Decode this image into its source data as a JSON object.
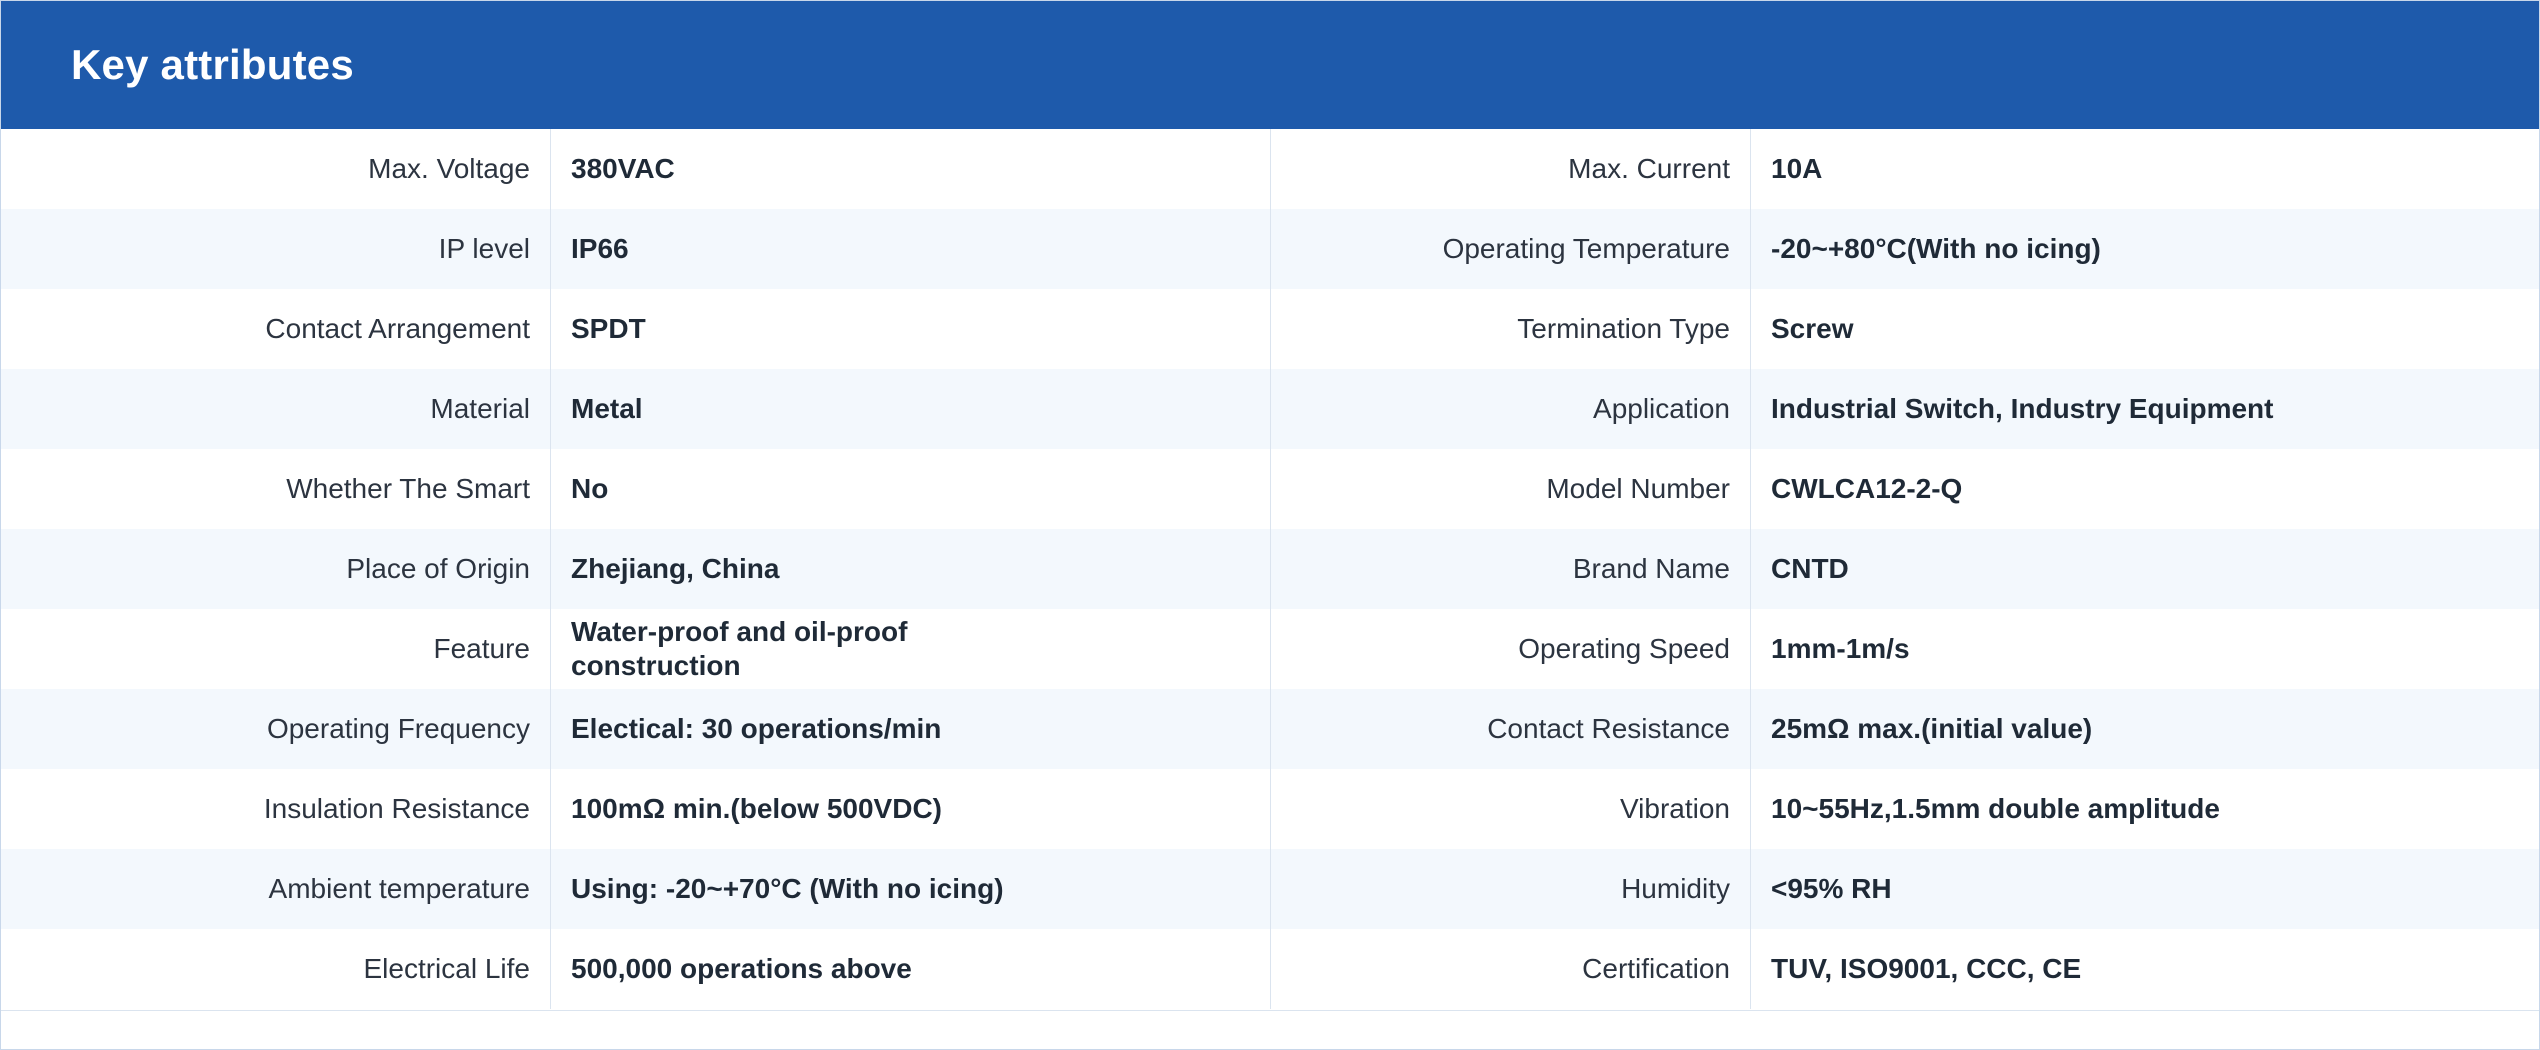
{
  "header": {
    "title": "Key attributes",
    "color": "#1e5aab"
  },
  "rows": [
    {
      "left_label": "Max. Voltage",
      "left_value": "380VAC",
      "right_label": "Max. Current",
      "right_value": "10A"
    },
    {
      "left_label": "IP level",
      "left_value": "IP66",
      "right_label": "Operating Temperature",
      "right_value": "-20~+80°C(With no icing)"
    },
    {
      "left_label": "Contact Arrangement",
      "left_value": "SPDT",
      "right_label": "Termination Type",
      "right_value": "Screw"
    },
    {
      "left_label": "Material",
      "left_value": "Metal",
      "right_label": "Application",
      "right_value": "Industrial Switch, Industry Equipment"
    },
    {
      "left_label": "Whether The Smart",
      "left_value": "No",
      "right_label": "Model Number",
      "right_value": "CWLCA12-2-Q"
    },
    {
      "left_label": "Place of Origin",
      "left_value": "Zhejiang, China",
      "right_label": "Brand Name",
      "right_value": "CNTD"
    },
    {
      "left_label": "Feature",
      "left_value": "Water-proof and oil-proof construction",
      "right_label": "Operating Speed",
      "right_value": "1mm-1m/s"
    },
    {
      "left_label": "Operating Frequency",
      "left_value": "Electical: 30 operations/min",
      "right_label": "Contact Resistance",
      "right_value": "25mΩ max.(initial value)"
    },
    {
      "left_label": "Insulation Resistance",
      "left_value": "100mΩ min.(below 500VDC)",
      "right_label": "Vibration",
      "right_value": "10~55Hz,1.5mm double amplitude"
    },
    {
      "left_label": "Ambient temperature",
      "left_value": "Using: -20~+70°C (With no icing)",
      "right_label": "Humidity",
      "right_value": "<95% RH"
    },
    {
      "left_label": "Electrical Life",
      "left_value": "500,000 operations above",
      "right_label": "Certification",
      "right_value": "TUV, ISO9001, CCC, CE"
    }
  ]
}
